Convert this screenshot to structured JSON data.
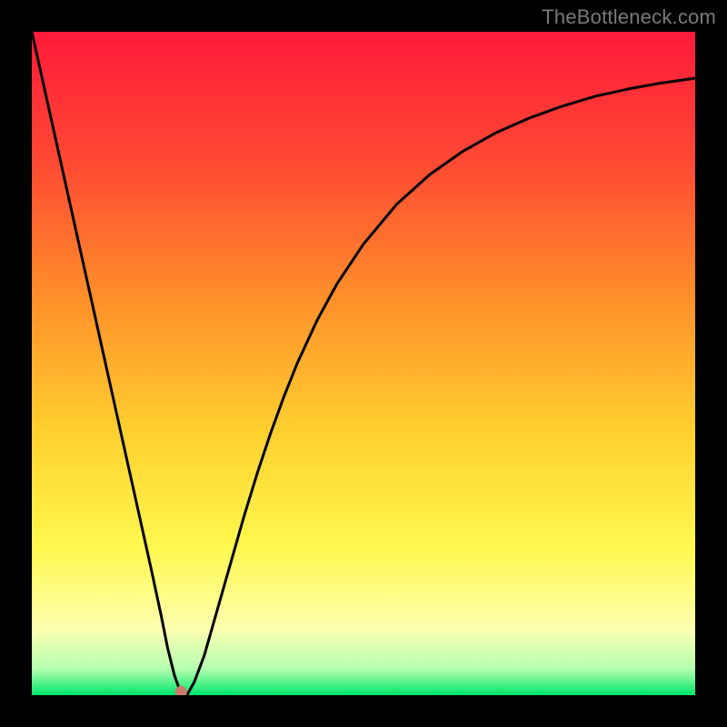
{
  "watermark": "TheBottleneck.com",
  "chart_data": {
    "type": "line",
    "title": "",
    "xlabel": "",
    "ylabel": "",
    "xlim": [
      0,
      100
    ],
    "ylim": [
      0,
      100
    ],
    "grid": false,
    "legend": false,
    "background_gradient": {
      "stops": [
        {
          "offset": 0.0,
          "color": "#ff1a3a"
        },
        {
          "offset": 0.2,
          "color": "#ff4a33"
        },
        {
          "offset": 0.4,
          "color": "#ff8f2a"
        },
        {
          "offset": 0.6,
          "color": "#ffcf2f"
        },
        {
          "offset": 0.78,
          "color": "#fff94f"
        },
        {
          "offset": 0.9,
          "color": "#fdffb0"
        },
        {
          "offset": 0.96,
          "color": "#b6ffb0"
        },
        {
          "offset": 1.0,
          "color": "#00e66a"
        }
      ]
    },
    "minimum_marker": {
      "x": 22.5,
      "y": 0.5,
      "color": "#c97a6a",
      "radius_pct": 0.9
    },
    "series": [
      {
        "name": "bottleneck-curve",
        "color": "#000000",
        "stroke_width": 3,
        "x": [
          0,
          2,
          4,
          6,
          8,
          10,
          12,
          14,
          16,
          18,
          19.5,
          20.5,
          21.5,
          22.5,
          23.5,
          24.5,
          26,
          28,
          30,
          32,
          34,
          36,
          38,
          40,
          43,
          46,
          50,
          55,
          60,
          65,
          70,
          75,
          80,
          85,
          90,
          95,
          100
        ],
        "y": [
          100,
          91,
          82,
          73,
          64,
          55,
          46,
          37,
          28,
          19,
          12,
          7,
          3,
          0.2,
          0.2,
          2,
          6,
          13,
          20,
          27,
          33.5,
          39.5,
          45,
          50,
          56.5,
          62,
          68,
          74,
          78.5,
          82,
          84.8,
          87,
          88.8,
          90.3,
          91.4,
          92.3,
          93
        ]
      }
    ]
  }
}
